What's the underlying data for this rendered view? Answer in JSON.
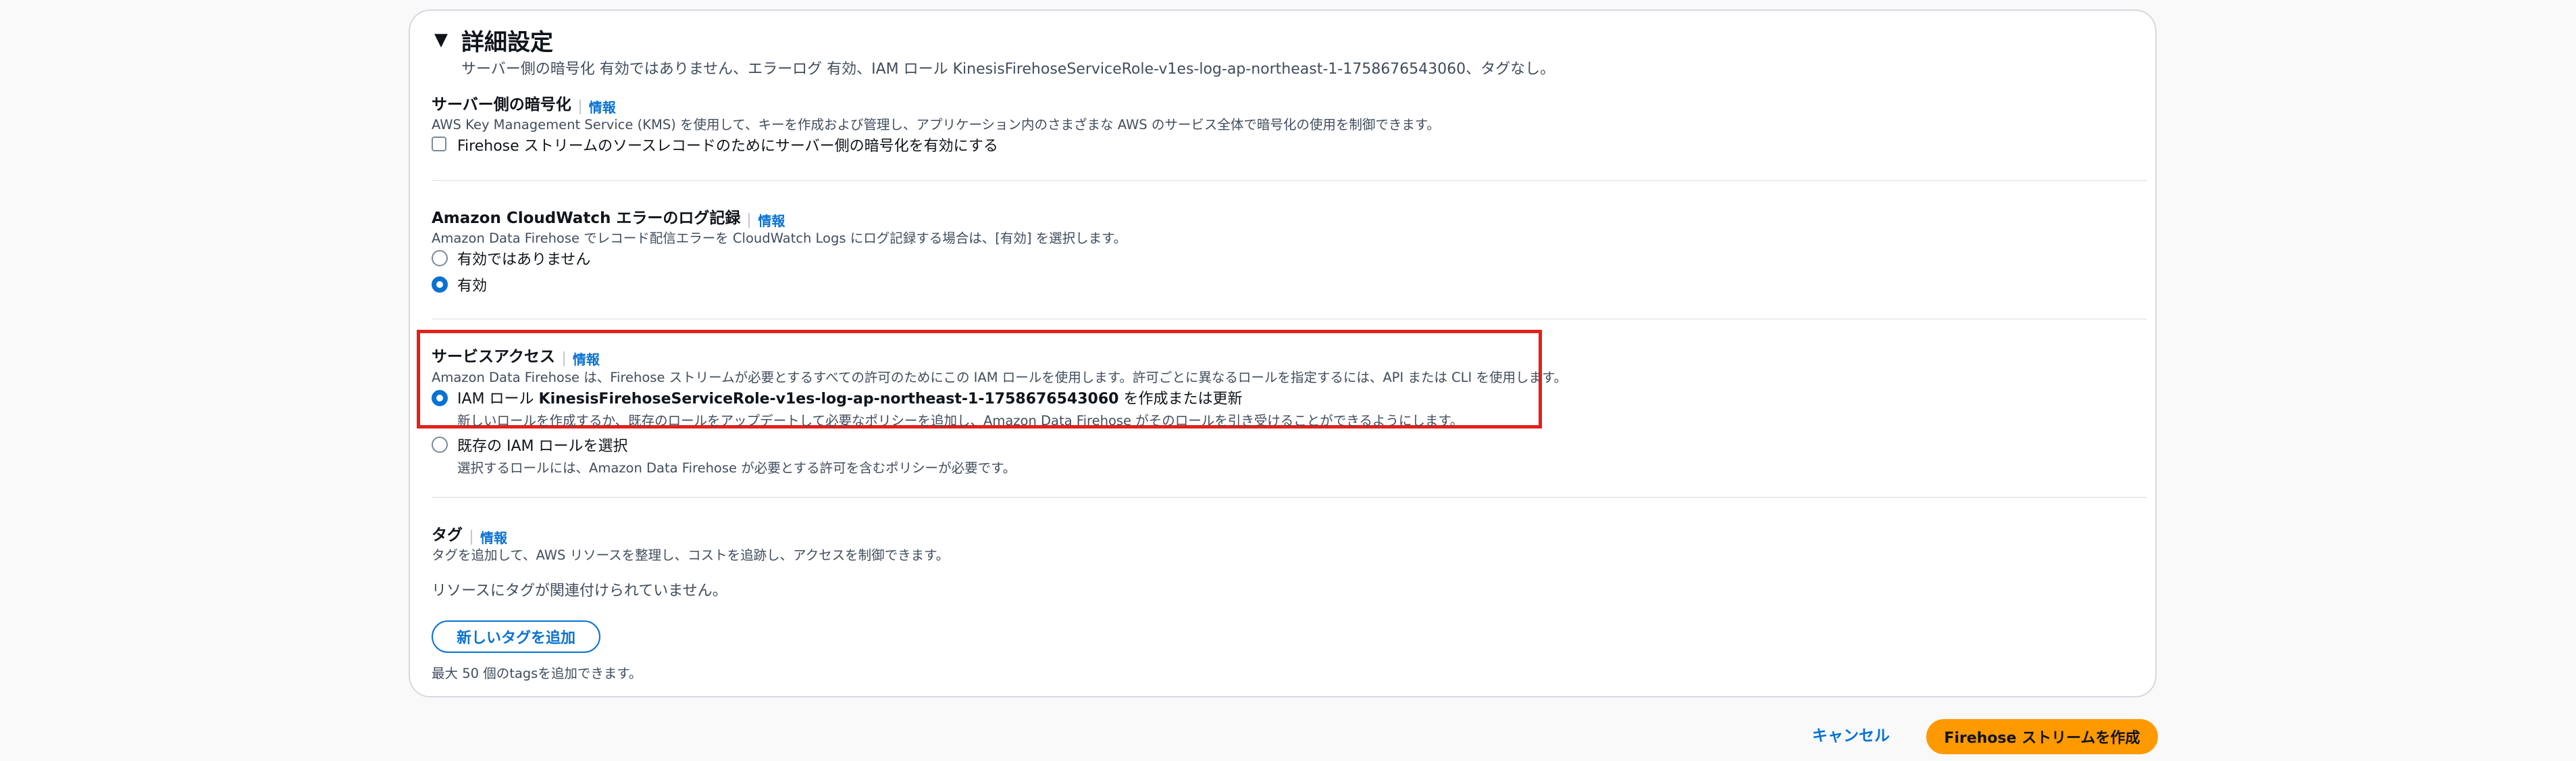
{
  "advanced": {
    "caret": "▼",
    "title": "詳細設定",
    "summary": "サーバー側の暗号化 有効ではありません、エラーログ 有効、IAM ロール KinesisFirehoseServiceRole-v1es-log-ap-northeast-1-1758676543060、タグなし。"
  },
  "encryption": {
    "label": "サーバー側の暗号化",
    "info": "情報",
    "description": "AWS Key Management Service (KMS) を使用して、キーを作成および管理し、アプリケーション内のさまざまな AWS のサービス全体で暗号化の使用を制御できます。",
    "checkbox_label": "Firehose ストリームのソースレコードのためにサーバー側の暗号化を有効にする",
    "checked": false
  },
  "cloudwatch": {
    "label": "Amazon CloudWatch エラーのログ記録",
    "info": "情報",
    "description": "Amazon Data Firehose でレコード配信エラーを CloudWatch Logs にログ記録する場合は、[有効] を選択します。",
    "options": [
      {
        "label": "有効ではありません",
        "selected": false
      },
      {
        "label": "有効",
        "selected": true
      }
    ]
  },
  "service_access": {
    "label": "サービスアクセス",
    "info": "情報",
    "description": "Amazon Data Firehose は、Firehose ストリームが必要とするすべての許可のためにこの IAM ロールを使用します。許可ごとに異なるロールを指定するには、API または CLI を使用します。",
    "option_create": {
      "prefix": "IAM ロール ",
      "role_name": "KinesisFirehoseServiceRole-v1es-log-ap-northeast-1-1758676543060",
      "suffix": " を作成または更新",
      "description": "新しいロールを作成するか、既存のロールをアップデートして必要なポリシーを追加し、Amazon Data Firehose がそのロールを引き受けることができるようにします。",
      "selected": true
    },
    "option_existing": {
      "label": "既存の IAM ロールを選択",
      "description": "選択するロールには、Amazon Data Firehose が必要とする許可を含むポリシーが必要です。",
      "selected": false
    }
  },
  "tags": {
    "label": "タグ",
    "info": "情報",
    "description": "タグを追加して、AWS リソースを整理し、コストを追跡し、アクセスを制御できます。",
    "empty_text": "リソースにタグが関連付けられていません。",
    "add_button": "新しいタグを追加",
    "limit_text": "最大 50 個のtagsを追加できます。"
  },
  "footer": {
    "cancel": "キャンセル",
    "create": "Firehose ストリームを作成"
  },
  "colors": {
    "accent": "#0972d3",
    "primary_button": "#ff9900",
    "highlight_border": "#e32119"
  }
}
